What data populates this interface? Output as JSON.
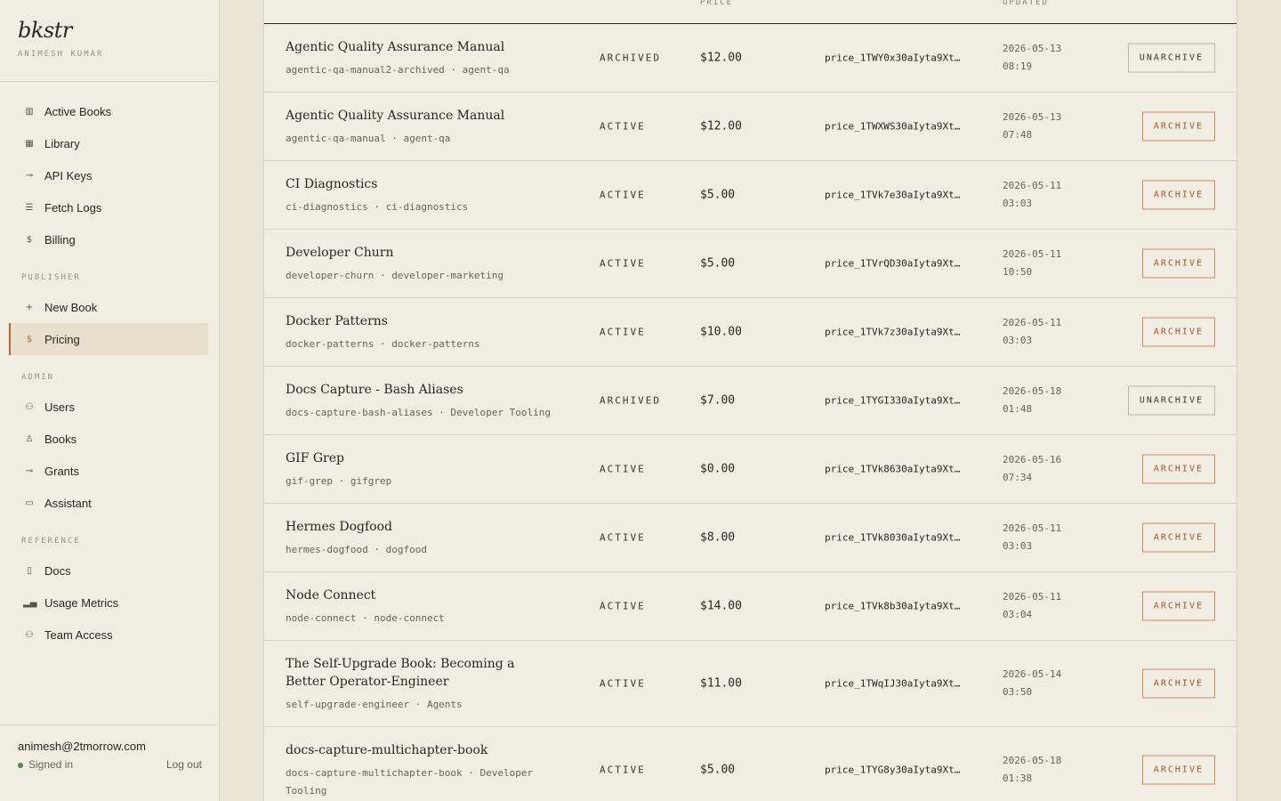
{
  "brand": {
    "logo": "bkstr",
    "user": "ANIMESH KUMAR"
  },
  "nav": {
    "main": [
      {
        "label": "Active Books",
        "icon": "columns-icon"
      },
      {
        "label": "Library",
        "icon": "grid-icon"
      },
      {
        "label": "API Keys",
        "icon": "key-icon"
      },
      {
        "label": "Fetch Logs",
        "icon": "list-icon"
      },
      {
        "label": "Billing",
        "icon": "dollar-icon"
      }
    ],
    "publisher_heading": "PUBLISHER",
    "publisher": [
      {
        "label": "New Book",
        "icon": "plus-icon"
      },
      {
        "label": "Pricing",
        "icon": "dollar-icon"
      }
    ],
    "admin_heading": "ADMIN",
    "admin": [
      {
        "label": "Users",
        "icon": "users-icon"
      },
      {
        "label": "Books",
        "icon": "person-icon"
      },
      {
        "label": "Grants",
        "icon": "key-icon"
      },
      {
        "label": "Assistant",
        "icon": "window-icon"
      }
    ],
    "reference_heading": "REFERENCE",
    "reference": [
      {
        "label": "Docs",
        "icon": "document-icon"
      },
      {
        "label": "Usage Metrics",
        "icon": "bar-chart-icon"
      },
      {
        "label": "Team Access",
        "icon": "users-icon"
      }
    ]
  },
  "footer": {
    "email": "animesh@2tmorrow.com",
    "status": "Signed in",
    "logout": "Log out"
  },
  "table": {
    "headers": {
      "price": "PRICE",
      "updated": "UPDATED"
    },
    "rows": [
      {
        "title": "Agentic Quality Assurance Manual",
        "meta": "agentic-qa-manual2-archived · agent-qa",
        "status": "ARCHIVED",
        "price": "$12.00",
        "price_id": "price_1TWY0x30aIyta9Xt…",
        "date": "2026-05-13",
        "time": "08:19",
        "action": "UNARCHIVE"
      },
      {
        "title": "Agentic Quality Assurance Manual",
        "meta": "agentic-qa-manual · agent-qa",
        "status": "ACTIVE",
        "price": "$12.00",
        "price_id": "price_1TWXWS30aIyta9Xt…",
        "date": "2026-05-13",
        "time": "07:48",
        "action": "ARCHIVE"
      },
      {
        "title": "CI Diagnostics",
        "meta": "ci-diagnostics · ci-diagnostics",
        "status": "ACTIVE",
        "price": "$5.00",
        "price_id": "price_1TVk7e30aIyta9Xt…",
        "date": "2026-05-11",
        "time": "03:03",
        "action": "ARCHIVE"
      },
      {
        "title": "Developer Churn",
        "meta": "developer-churn · developer-marketing",
        "status": "ACTIVE",
        "price": "$5.00",
        "price_id": "price_1TVrQD30aIyta9Xt…",
        "date": "2026-05-11",
        "time": "10:50",
        "action": "ARCHIVE"
      },
      {
        "title": "Docker Patterns",
        "meta": "docker-patterns · docker-patterns",
        "status": "ACTIVE",
        "price": "$10.00",
        "price_id": "price_1TVk7z30aIyta9Xt…",
        "date": "2026-05-11",
        "time": "03:03",
        "action": "ARCHIVE"
      },
      {
        "title": "Docs Capture - Bash Aliases",
        "meta": "docs-capture-bash-aliases · Developer Tooling",
        "status": "ARCHIVED",
        "price": "$7.00",
        "price_id": "price_1TYGI330aIyta9Xt…",
        "date": "2026-05-18",
        "time": "01:48",
        "action": "UNARCHIVE"
      },
      {
        "title": "GIF Grep",
        "meta": "gif-grep · gifgrep",
        "status": "ACTIVE",
        "price": "$0.00",
        "price_id": "price_1TVk8630aIyta9Xt…",
        "date": "2026-05-16",
        "time": "07:34",
        "action": "ARCHIVE"
      },
      {
        "title": "Hermes Dogfood",
        "meta": "hermes-dogfood · dogfood",
        "status": "ACTIVE",
        "price": "$8.00",
        "price_id": "price_1TVk8030aIyta9Xt…",
        "date": "2026-05-11",
        "time": "03:03",
        "action": "ARCHIVE"
      },
      {
        "title": "Node Connect",
        "meta": "node-connect · node-connect",
        "status": "ACTIVE",
        "price": "$14.00",
        "price_id": "price_1TVk8b30aIyta9Xt…",
        "date": "2026-05-11",
        "time": "03:04",
        "action": "ARCHIVE"
      },
      {
        "title": "The Self-Upgrade Book: Becoming a Better Operator-Engineer",
        "meta": "self-upgrade-engineer · Agents",
        "status": "ACTIVE",
        "price": "$11.00",
        "price_id": "price_1TWqIJ30aIyta9Xt…",
        "date": "2026-05-14",
        "time": "03:50",
        "action": "ARCHIVE"
      },
      {
        "title": "docs-capture-multichapter-book",
        "meta": "docs-capture-multichapter-book · Developer Tooling",
        "status": "ACTIVE",
        "price": "$5.00",
        "price_id": "price_1TYG8y30aIyta9Xt…",
        "date": "2026-05-18",
        "time": "01:38",
        "action": "ARCHIVE"
      }
    ]
  }
}
